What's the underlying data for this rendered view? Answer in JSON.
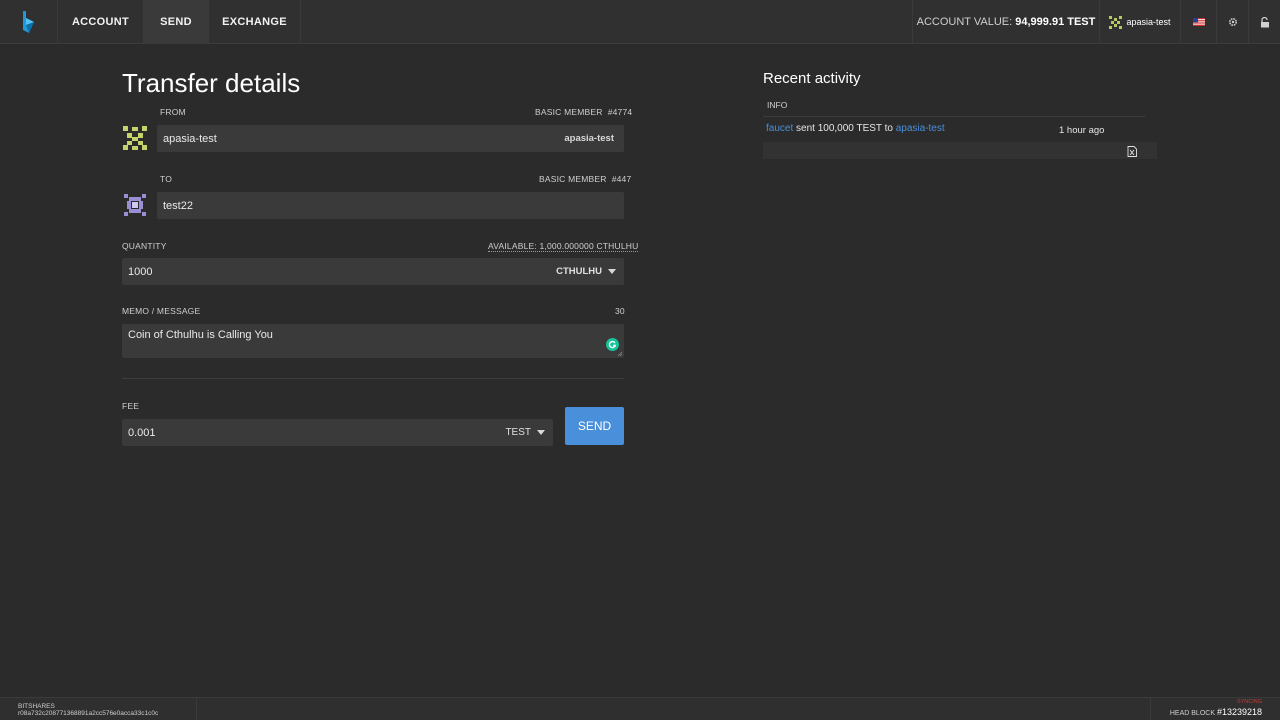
{
  "nav": {
    "tabs": [
      {
        "label": "ACCOUNT"
      },
      {
        "label": "SEND"
      },
      {
        "label": "EXCHANGE"
      }
    ],
    "account_value_label": "ACCOUNT VALUE:",
    "account_value": "94,999.91 TEST",
    "account_name": "apasia-test"
  },
  "transfer": {
    "title": "Transfer details",
    "from_label": "FROM",
    "from_member_type": "BASIC MEMBER",
    "from_member_number": "#4774",
    "from_value": "apasia-test",
    "from_account_tag": "apasia-test",
    "to_label": "TO",
    "to_member_type": "BASIC MEMBER",
    "to_member_number": "#447",
    "to_value": "test22",
    "quantity_label": "QUANTITY",
    "available_text": "AVAILABLE: 1,000.000000 CTHULHU",
    "quantity_value": "1000",
    "quantity_asset": "CTHULHU",
    "memo_label": "MEMO / MESSAGE",
    "memo_count": "30",
    "memo_value": "Coin of Cthulhu is Calling You",
    "fee_label": "FEE",
    "fee_value": "0.001",
    "fee_asset": "TEST",
    "send_label": "SEND"
  },
  "activity": {
    "title": "Recent activity",
    "col_info": "INFO",
    "rows": [
      {
        "from": "faucet",
        "action": "sent 100,000 TEST to",
        "to": "apasia-test",
        "time": "1 hour ago"
      }
    ]
  },
  "footer": {
    "version": "BITSHARES r08a732c208771368891a2cc576e0acca33c1c0c",
    "head_block_label": "HEAD BLOCK",
    "head_block_value": "#13239218",
    "status": "SYNCING"
  },
  "colors": {
    "accent": "#4a8fd9",
    "background": "#2b2b2b",
    "field": "#3a3a3a"
  },
  "icons": {
    "logo": "bitshares-logo-icon",
    "flag": "us-flag-icon",
    "settings": "gear-icon",
    "lock": "unlock-icon",
    "grammarly": "grammarly-icon",
    "export": "csv-export-icon"
  }
}
